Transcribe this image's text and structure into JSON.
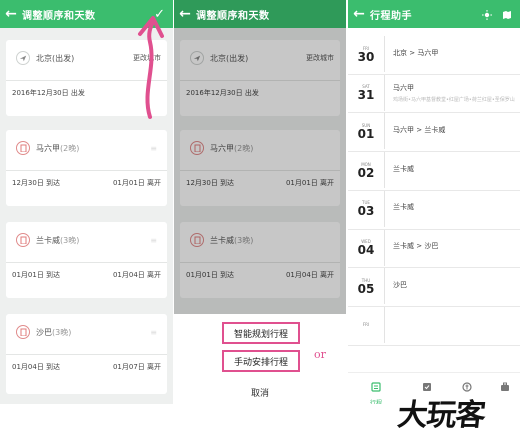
{
  "panel1": {
    "back_icon": "back-arrow-icon",
    "title": "调整顺序和天数",
    "confirm_icon": "checkmark-icon",
    "cards": [
      {
        "icon": "plane-icon",
        "name": "北京(出发)",
        "nights": "",
        "action": "更改城市",
        "left": "2016年12月30日 出发",
        "right": ""
      },
      {
        "icon": "building-icon",
        "name": "马六甲",
        "nights": "(2晚)",
        "action": "",
        "left": "12月30日 到达",
        "right": "01月01日 离开"
      },
      {
        "icon": "building-icon",
        "name": "兰卡威",
        "nights": "(3晚)",
        "action": "",
        "left": "01月01日 到达",
        "right": "01月04日 离开"
      },
      {
        "icon": "building-icon",
        "name": "沙巴",
        "nights": "(3晚)",
        "action": "",
        "left": "01月04日 到达",
        "right": "01月07日 离开"
      }
    ]
  },
  "panel2": {
    "title": "调整顺序和天数",
    "cards": [
      {
        "name": "北京(出发)",
        "nights": "",
        "action": "更改城市",
        "left": "2016年12月30日 出发",
        "right": ""
      },
      {
        "name": "马六甲",
        "nights": "(2晚)",
        "action": "",
        "left": "12月30日 到达",
        "right": "01月01日 离开"
      },
      {
        "name": "兰卡威",
        "nights": "(3晚)",
        "action": "",
        "left": "01月01日 到达",
        "right": "01月04日 离开"
      }
    ],
    "option_smart": "智能规划行程",
    "option_manual": "手动安排行程",
    "or_label": "or",
    "cancel": "取消"
  },
  "panel3": {
    "title": "行程助手",
    "icons": [
      "sun-icon",
      "map-icon"
    ],
    "days": [
      {
        "week": "FRI",
        "day": "30",
        "main": "北京 > 马六甲",
        "sub": ""
      },
      {
        "week": "SAT",
        "day": "31",
        "main": "马六甲",
        "sub": "鸡场街•马六甲基督教堂•红屋广场•荷兰红屋•圣保罗山"
      },
      {
        "week": "SUN",
        "day": "01",
        "main": "马六甲 > 兰卡威",
        "sub": ""
      },
      {
        "week": "MON",
        "day": "02",
        "main": "兰卡威",
        "sub": ""
      },
      {
        "week": "TUE",
        "day": "03",
        "main": "兰卡威",
        "sub": ""
      },
      {
        "week": "WED",
        "day": "04",
        "main": "兰卡威 > 沙巴",
        "sub": ""
      },
      {
        "week": "THU",
        "day": "05",
        "main": "沙巴",
        "sub": ""
      },
      {
        "week": "FRI",
        "day": "",
        "main": "",
        "sub": ""
      }
    ],
    "nav": [
      {
        "icon": "itinerary-icon",
        "label": "行程"
      },
      {
        "icon": "checklist-icon",
        "label": ""
      },
      {
        "icon": "currency-icon",
        "label": ""
      },
      {
        "icon": "suitcase-icon",
        "label": ""
      }
    ]
  },
  "watermark": "大玩客",
  "colors": {
    "green": "#3bbd6e",
    "pink": "#e0508f"
  }
}
